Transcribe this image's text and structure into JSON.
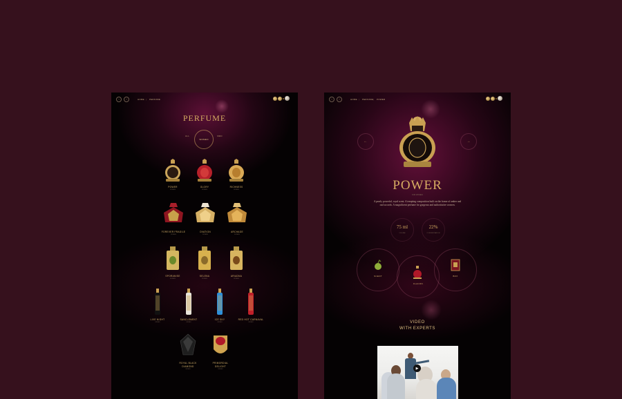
{
  "left": {
    "nav": {
      "back": "‹",
      "forward": "›"
    },
    "breadcrumb": [
      "HOME",
      "PERFUME"
    ],
    "title": "PERFUME",
    "filters": [
      "ALL",
      "WOMEN",
      "MEN"
    ],
    "products": [
      {
        "name": "POWER",
        "sub": "WOMEN"
      },
      {
        "name": "GLORY",
        "sub": "WOMEN"
      },
      {
        "name": "RICHNESS",
        "sub": "WOMEN"
      },
      {
        "name": "FOREVER FRAGILE",
        "sub": "WOMEN"
      },
      {
        "name": "OVATION",
        "sub": "WOMEN"
      },
      {
        "name": "ARCHAGE",
        "sub": "WOMEN"
      },
      {
        "name": "SPORANISE",
        "sub": "WOMEN"
      },
      {
        "name": "SELENA",
        "sub": "WOMEN"
      },
      {
        "name": "ARIADNA",
        "sub": "WOMEN"
      },
      {
        "name": "LIVE NIGHT",
        "sub": "UNISEX"
      },
      {
        "name": "SANCLEMENT",
        "sub": "UNISEX"
      },
      {
        "name": "ICE SKY",
        "sub": "UNISEX"
      },
      {
        "name": "RED HOT CARNAVAL",
        "sub": "UNISEX"
      },
      {
        "name": "ROYAL BLACK DIAMOND",
        "sub": "UNISEX"
      },
      {
        "name": "PRIMORDIAL DELIGHT",
        "sub": "UNISEX"
      }
    ]
  },
  "right": {
    "nav": {
      "back": "‹",
      "forward": "›"
    },
    "breadcrumb": [
      "HOME",
      "PERFUME",
      "POWER"
    ],
    "prev_arrow": "←",
    "next_arrow": "→",
    "title": "POWER",
    "subtitle": "FOR WOMEN",
    "description": "A pearly powerful, royal scent. A tempting composition built on the frame of amber and oud accords. A magnificent perfume for gorgeous and authoritative women.",
    "stats": [
      {
        "value": "75 ml",
        "label": "VOLUME"
      },
      {
        "value": "22%",
        "label": "CONCENTRATION"
      }
    ],
    "circles": [
      {
        "label": "SCENT"
      },
      {
        "label": "FLACON"
      },
      {
        "label": "BOX"
      }
    ],
    "video_title_1": "VIDEO",
    "video_title_2": "WITH EXPERTS",
    "play_icon": "▶"
  },
  "colors": {
    "backdrop": "#36111d",
    "gold": "#d6ac62",
    "glow": "#5a0f35"
  }
}
